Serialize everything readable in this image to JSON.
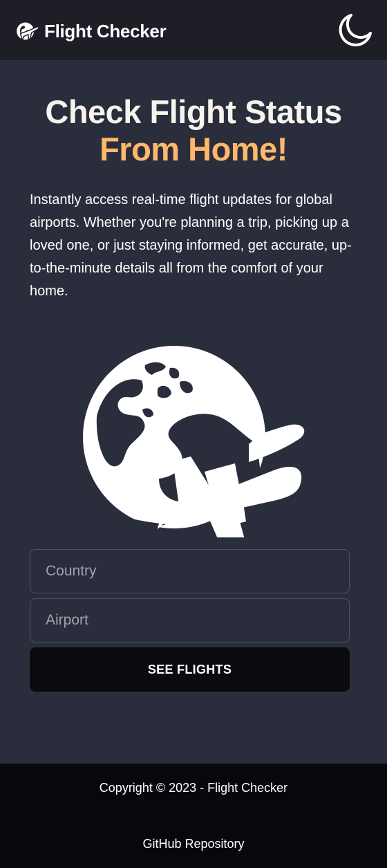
{
  "app": {
    "name": "Flight Checker",
    "logo_icon": "globe-plane-icon",
    "theme_toggle_icon": "moon-icon"
  },
  "hero": {
    "title_line1": "Check Flight Status",
    "title_line2": "From Home!",
    "description": "Instantly access real-time flight updates for global airports. Whether you're planning a trip, picking up a loved one, or just staying informed, get accurate, up-to-the-minute details all from the comfort of your home.",
    "illustration_icon": "globe-plane-icon"
  },
  "search": {
    "country_placeholder": "Country",
    "country_value": "",
    "airport_placeholder": "Airport",
    "airport_value": "",
    "submit_label": "SEE FLIGHTS"
  },
  "footer": {
    "copyright": "Copyright © 2023 - Flight Checker",
    "github_label": "GitHub Repository"
  },
  "colors": {
    "navbar_bg": "#1d1e26",
    "page_bg": "#2a2e3c",
    "accent": "#ffb86b",
    "button_bg": "#0b0b0f",
    "footer_bg": "#08080c"
  }
}
